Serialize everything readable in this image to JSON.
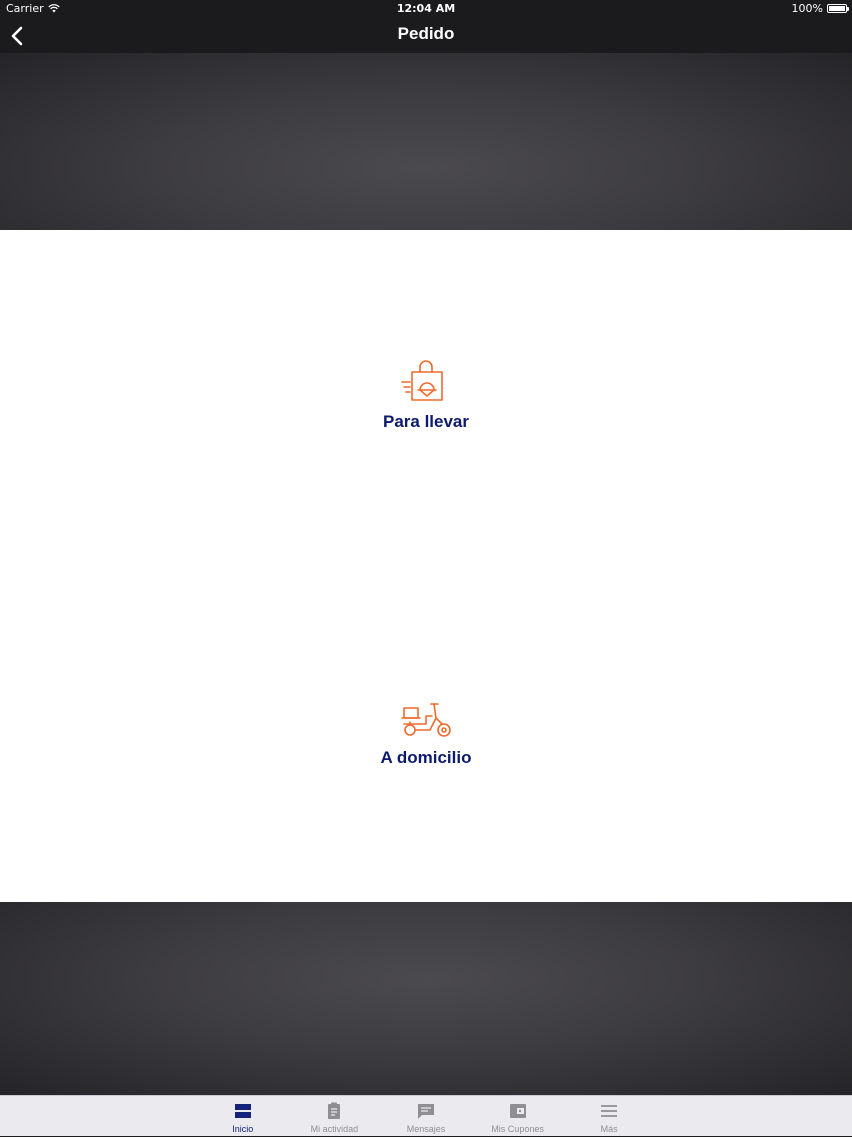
{
  "status_bar": {
    "carrier": "Carrier",
    "time": "12:04 AM",
    "battery": "100%"
  },
  "nav": {
    "title": "Pedido",
    "back_icon": "chevron-left-icon"
  },
  "options": [
    {
      "label": "Para llevar",
      "icon": "takeaway-bag-icon"
    },
    {
      "label": "A domicilio",
      "icon": "delivery-scooter-icon"
    }
  ],
  "tab_bar": {
    "items": [
      {
        "label": "Inicio",
        "icon": "home-icon",
        "active": true
      },
      {
        "label": "Mi actividad",
        "icon": "clipboard-icon",
        "active": false
      },
      {
        "label": "Mensajes",
        "icon": "message-icon",
        "active": false
      },
      {
        "label": "Mis Cupones",
        "icon": "wallet-icon",
        "active": false
      },
      {
        "label": "Más",
        "icon": "menu-icon",
        "active": false
      }
    ]
  },
  "colors": {
    "accent_orange": "#ee6a2c",
    "label_navy": "#0e1a6e",
    "tab_active": "#14237a",
    "tab_inactive": "#8e8e93"
  }
}
